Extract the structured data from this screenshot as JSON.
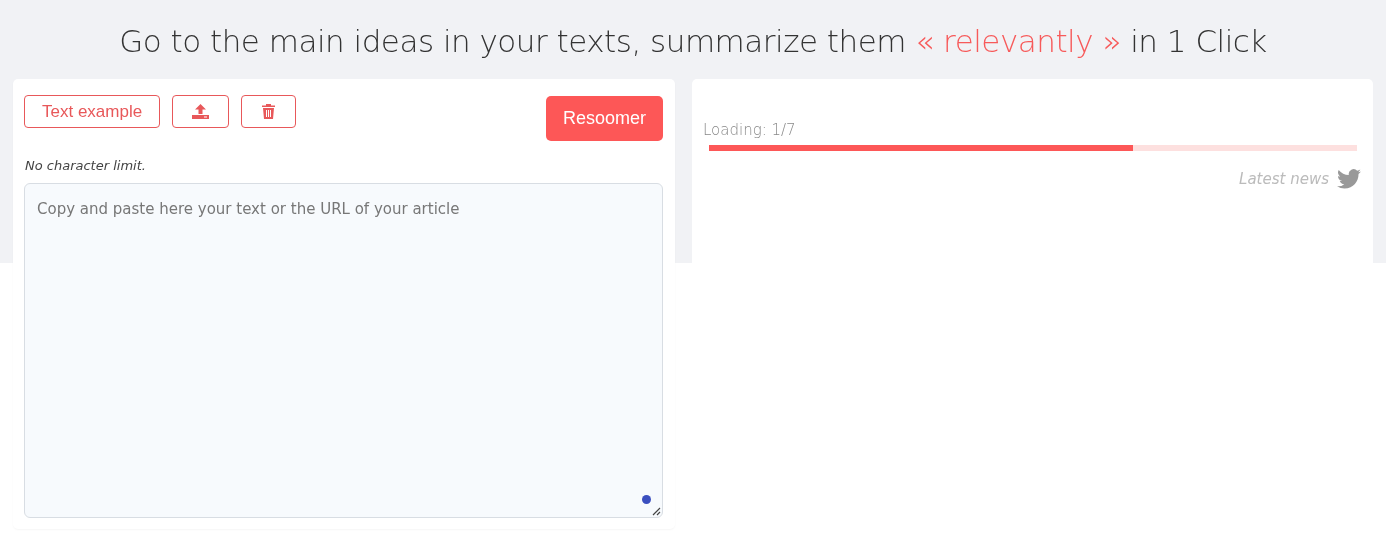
{
  "heading": {
    "before": "Go to the main ideas in your texts, summarize them ",
    "highlight": "« relevantly »",
    "after": " in 1 Click"
  },
  "editor": {
    "example_button": "Text example",
    "submit_button": "Resoomer",
    "note": "No character limit.",
    "placeholder": "Copy and paste here your text or the URL of your article"
  },
  "result": {
    "progress_label": "Loading: 1/7",
    "progress": {
      "level": 0.655
    },
    "news_link": "Latest news"
  }
}
